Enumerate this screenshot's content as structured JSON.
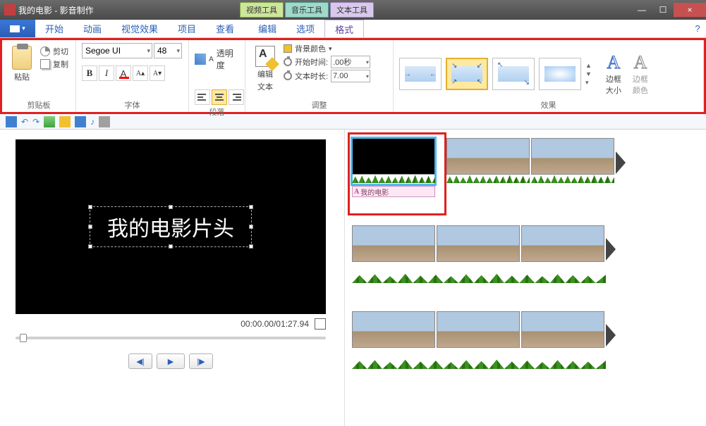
{
  "title": "我的电影 - 影音制作",
  "tool_tabs": {
    "video": "视频工具",
    "audio": "音乐工具",
    "text": "文本工具"
  },
  "win": {
    "min": "—",
    "max": "☐",
    "close": "×"
  },
  "menu": {
    "home": "开始",
    "anim": "动画",
    "vis": "视觉效果",
    "proj": "项目",
    "view": "查看",
    "edit": "编辑",
    "opt": "选项",
    "fmt": "格式",
    "help": "?"
  },
  "ribbon": {
    "clipboard": {
      "paste": "粘贴",
      "cut": "剪切",
      "copy": "复制",
      "label": "剪贴板"
    },
    "font": {
      "name": "Segoe UI",
      "size": "48",
      "bold": "B",
      "italic": "I",
      "color": "A",
      "grow": "A▴",
      "shrink": "A▾",
      "label": "字体"
    },
    "trans": {
      "label": "透明度"
    },
    "para": {
      "label": "段落"
    },
    "edit_text": {
      "line1": "编辑",
      "line2": "文本"
    },
    "adjust": {
      "bg": "背景颜色",
      "start": "开始时间:",
      "dur": "文本时长:",
      "start_v": ".00秒",
      "dur_v": "7.00",
      "label": "调整"
    },
    "effects": {
      "label": "效果",
      "border_size": "边框\n大小",
      "border_color": "边框\n颜色"
    }
  },
  "preview": {
    "title_text": "我的电影片头",
    "time": "00:00.00/01:27.94"
  },
  "timeline": {
    "caption": "我的电影"
  },
  "play": {
    "prev": "◀|",
    "play": "▶",
    "next": "|▶"
  }
}
